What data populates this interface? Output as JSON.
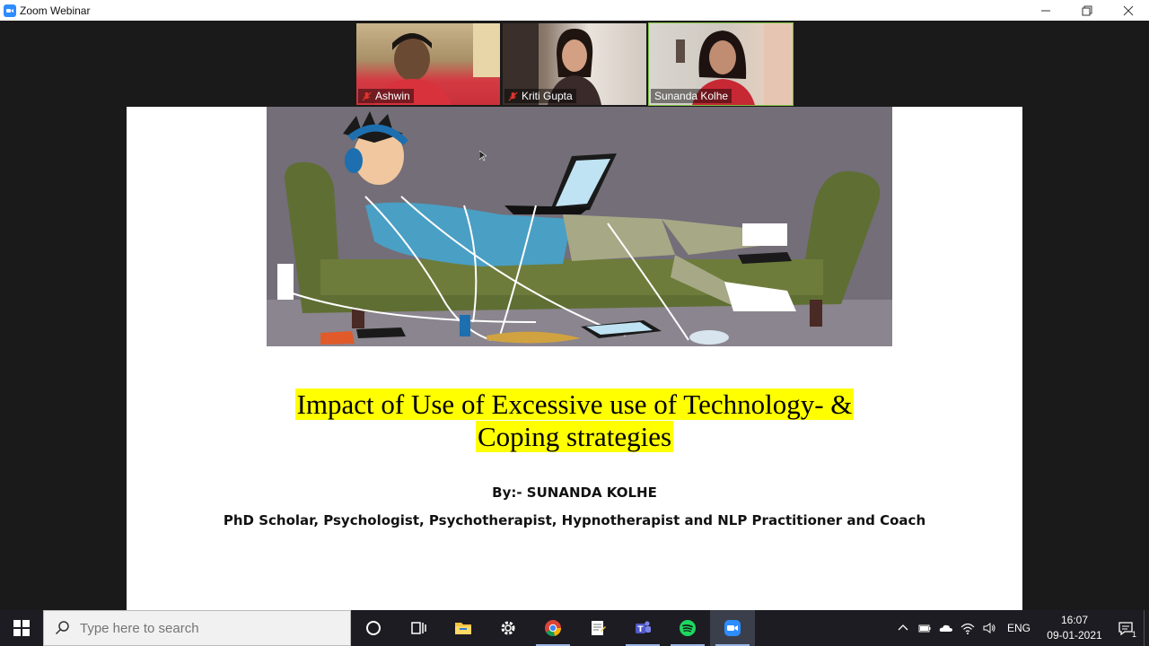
{
  "window": {
    "title": "Zoom Webinar"
  },
  "participants": [
    {
      "name": "Ashwin",
      "muted": true
    },
    {
      "name": "Kriti Gupta",
      "muted": true
    },
    {
      "name": "Sunanda Kolhe",
      "muted": false,
      "active_speaker": true
    }
  ],
  "slide": {
    "title_line1": "Impact of Use of Excessive use of Technology- &",
    "title_line2": "Coping strategies",
    "byline": "By:- SUNANDA KOLHE",
    "credentials": "PhD Scholar, Psychologist, Psychotherapist, Hypnotherapist and NLP Practitioner and Coach",
    "highlight_color": "#ffff00"
  },
  "taskbar": {
    "search_placeholder": "Type here to search",
    "apps": [
      "cortana-icon",
      "task-view-icon",
      "file-explorer-icon",
      "settings-icon",
      "chrome-icon",
      "notepad-icon",
      "teams-icon",
      "spotify-icon",
      "zoom-icon"
    ],
    "language": "ENG",
    "time": "16:07",
    "date": "09-01-2021",
    "notification_count": "1"
  },
  "colors": {
    "zoom_blue": "#2d8cff",
    "active_speaker_border": "#7dc142",
    "taskbar": "#1c1c22"
  }
}
